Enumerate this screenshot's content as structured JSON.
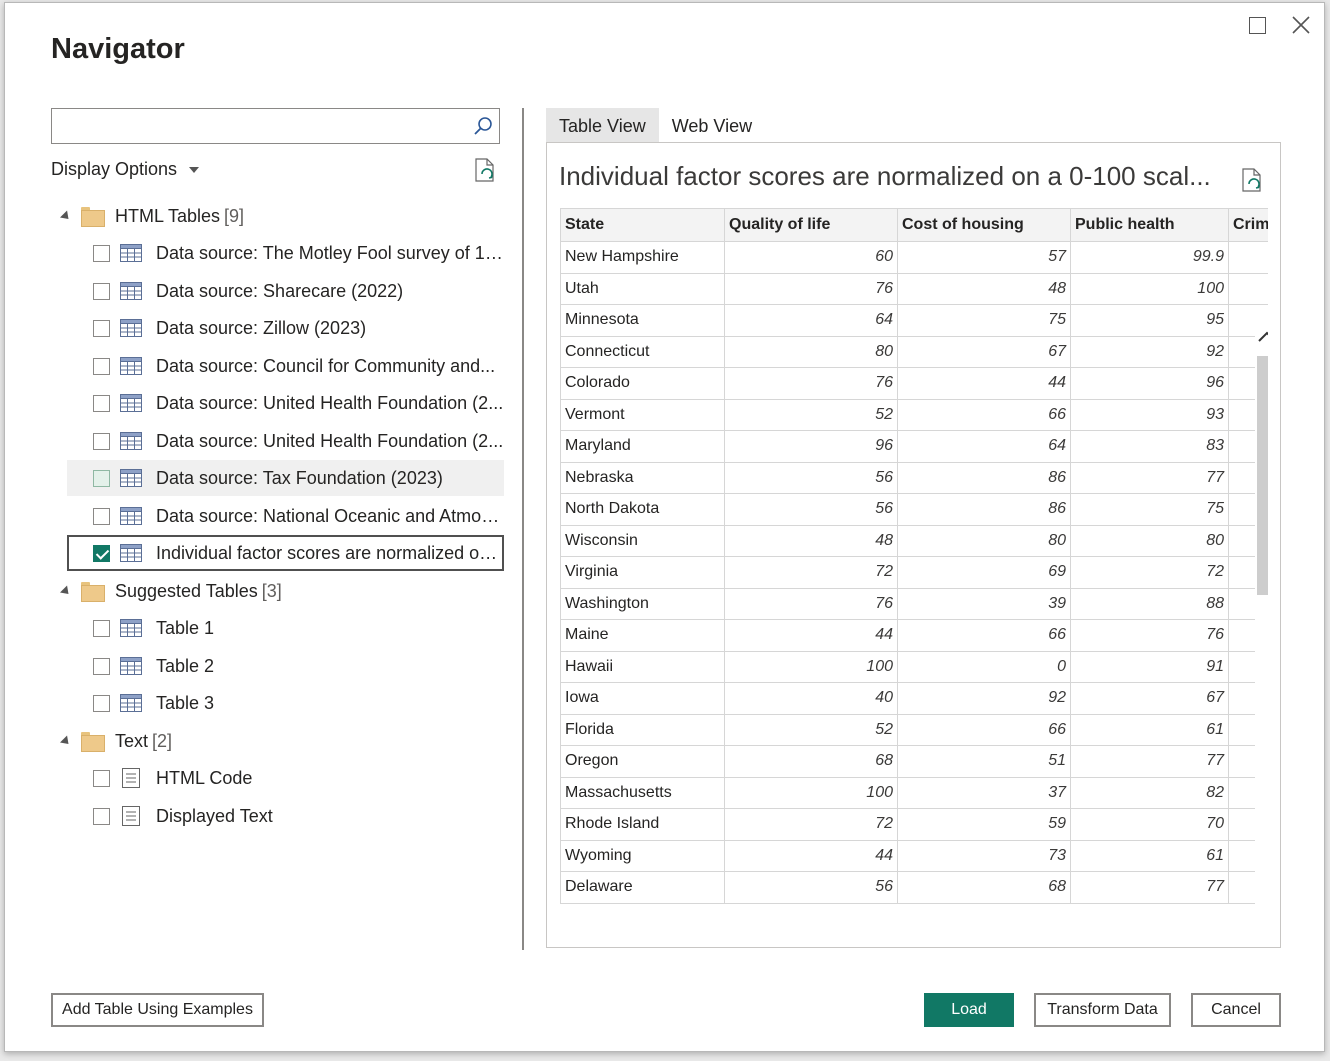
{
  "window": {
    "title": "Navigator",
    "maximize_label": "Maximize",
    "close_label": "Close"
  },
  "search": {
    "value": "",
    "placeholder": ""
  },
  "display_options": {
    "label": "Display Options"
  },
  "tree": {
    "html_tables": {
      "label": "HTML Tables",
      "count": "[9]",
      "items": [
        {
          "label": "Data source: The Motley Fool survey of 1,...",
          "state": "unchecked"
        },
        {
          "label": "Data source: Sharecare (2022)",
          "state": "unchecked"
        },
        {
          "label": "Data source: Zillow (2023)",
          "state": "unchecked"
        },
        {
          "label": "Data source: Council for Community and...",
          "state": "unchecked"
        },
        {
          "label": "Data source: United Health Foundation (2...",
          "state": "unchecked"
        },
        {
          "label": "Data source: United Health Foundation (2...",
          "state": "unchecked"
        },
        {
          "label": "Data source: Tax Foundation (2023)",
          "state": "hover"
        },
        {
          "label": "Data source: National Oceanic and Atmos...",
          "state": "unchecked"
        },
        {
          "label": "Individual factor scores are normalized on...",
          "state": "checked"
        }
      ]
    },
    "suggested_tables": {
      "label": "Suggested Tables",
      "count": "[3]",
      "items": [
        {
          "label": "Table 1",
          "state": "unchecked"
        },
        {
          "label": "Table 2",
          "state": "unchecked"
        },
        {
          "label": "Table 3",
          "state": "unchecked"
        }
      ]
    },
    "text": {
      "label": "Text",
      "count": "[2]",
      "items": [
        {
          "label": "HTML Code",
          "state": "unchecked"
        },
        {
          "label": "Displayed Text",
          "state": "unchecked"
        }
      ]
    }
  },
  "tabs": [
    {
      "label": "Table View",
      "active": true
    },
    {
      "label": "Web View",
      "active": false
    }
  ],
  "preview": {
    "title": "Individual factor scores are normalized on a 0-100 scal...",
    "columns": [
      "State",
      "Quality of life",
      "Cost of housing",
      "Public health",
      "Crime"
    ],
    "rows": [
      [
        "New Hampshire",
        "60",
        "57",
        "99.9"
      ],
      [
        "Utah",
        "76",
        "48",
        "100"
      ],
      [
        "Minnesota",
        "64",
        "75",
        "95"
      ],
      [
        "Connecticut",
        "80",
        "67",
        "92"
      ],
      [
        "Colorado",
        "76",
        "44",
        "96"
      ],
      [
        "Vermont",
        "52",
        "66",
        "93"
      ],
      [
        "Maryland",
        "96",
        "64",
        "83"
      ],
      [
        "Nebraska",
        "56",
        "86",
        "77"
      ],
      [
        "North Dakota",
        "56",
        "86",
        "75"
      ],
      [
        "Wisconsin",
        "48",
        "80",
        "80"
      ],
      [
        "Virginia",
        "72",
        "69",
        "72"
      ],
      [
        "Washington",
        "76",
        "39",
        "88"
      ],
      [
        "Maine",
        "44",
        "66",
        "76"
      ],
      [
        "Hawaii",
        "100",
        "0",
        "91"
      ],
      [
        "Iowa",
        "40",
        "92",
        "67"
      ],
      [
        "Florida",
        "52",
        "66",
        "61"
      ],
      [
        "Oregon",
        "68",
        "51",
        "77"
      ],
      [
        "Massachusetts",
        "100",
        "37",
        "82"
      ],
      [
        "Rhode Island",
        "72",
        "59",
        "70"
      ],
      [
        "Wyoming",
        "44",
        "73",
        "61"
      ],
      [
        "Delaware",
        "56",
        "68",
        "77"
      ]
    ]
  },
  "buttons": {
    "add_table": "Add Table Using Examples",
    "load": "Load",
    "transform": "Transform Data",
    "cancel": "Cancel"
  },
  "colors": {
    "accent": "#117865",
    "hover_row": "#f0f0f0",
    "header_bg": "#f3f3f3"
  }
}
